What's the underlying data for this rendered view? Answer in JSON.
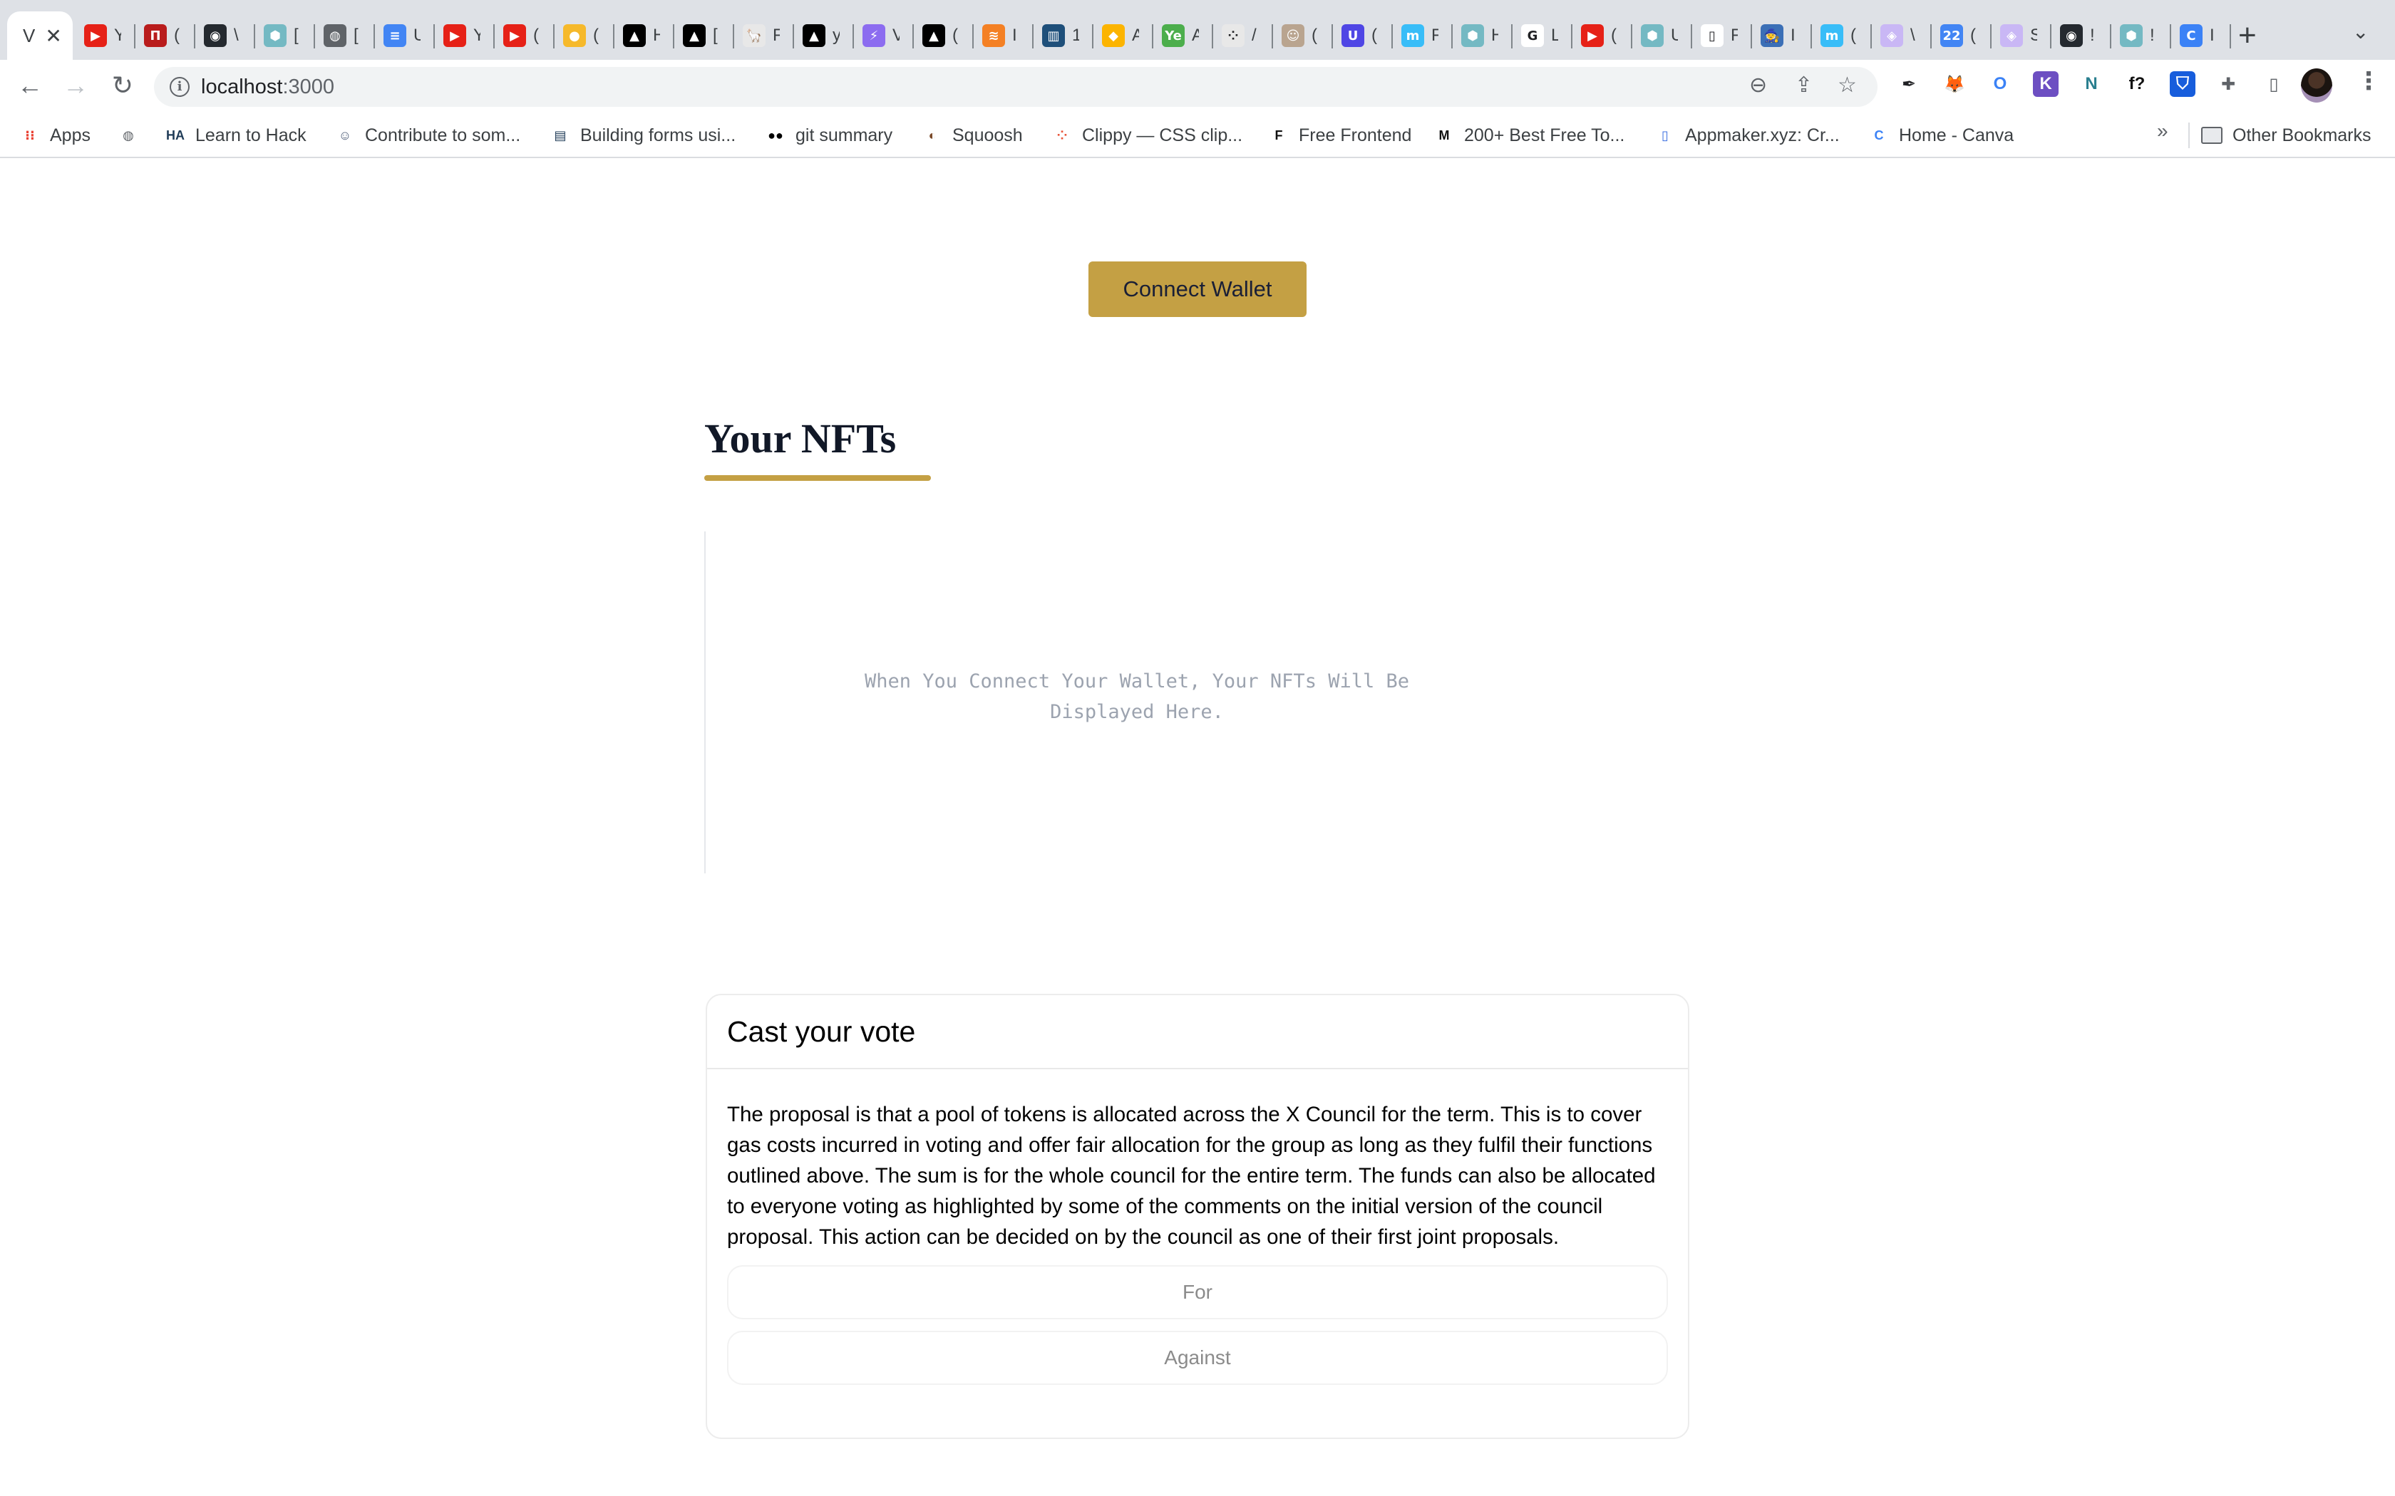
{
  "browser": {
    "active_tab": {
      "label": "V",
      "close": "✕"
    },
    "tabs": [
      {
        "icon": "youtube-music-icon",
        "label": "Y",
        "color": "#e62117",
        "glyph": "▶"
      },
      {
        "icon": "mdn-icon",
        "label": "(",
        "color": "#b91c1c",
        "glyph": "П"
      },
      {
        "icon": "github-icon",
        "label": "\\",
        "color": "#24292f",
        "glyph": "◉"
      },
      {
        "icon": "cube-icon",
        "label": "[",
        "color": "#74b9c3",
        "glyph": "⬢"
      },
      {
        "icon": "globe-icon",
        "label": "[",
        "color": "#5f6368",
        "glyph": "◍"
      },
      {
        "icon": "google-docs-icon",
        "label": "U",
        "color": "#4285f4",
        "glyph": "≡"
      },
      {
        "icon": "youtube-music-icon",
        "label": "Y",
        "color": "#e62117",
        "glyph": "▶"
      },
      {
        "icon": "youtube-icon",
        "label": "(",
        "color": "#e62117",
        "glyph": "▶"
      },
      {
        "icon": "keep-icon",
        "label": "(",
        "color": "#f6b92b",
        "glyph": "●"
      },
      {
        "icon": "vercel-icon",
        "label": "H",
        "color": "#000000",
        "glyph": "▲"
      },
      {
        "icon": "vercel-icon",
        "label": "[",
        "color": "#000000",
        "glyph": "▲"
      },
      {
        "icon": "llama-icon",
        "label": "F",
        "color": "#e8e8e8",
        "glyph": "🦙"
      },
      {
        "icon": "vercel-icon",
        "label": "y",
        "color": "#000000",
        "glyph": "▲"
      },
      {
        "icon": "vite-icon",
        "label": "V",
        "color": "#8c6cf0",
        "glyph": "⚡"
      },
      {
        "icon": "vercel-icon",
        "label": "(",
        "color": "#000000",
        "glyph": "▲"
      },
      {
        "icon": "stackoverflow-icon",
        "label": "I",
        "color": "#f48024",
        "glyph": "≋"
      },
      {
        "icon": "chart-image-icon",
        "label": "1",
        "color": "#1e4f7a",
        "glyph": "▥"
      },
      {
        "icon": "airtable-icon",
        "label": "A",
        "color": "#fcb400",
        "glyph": "◆"
      },
      {
        "icon": "ye-icon",
        "label": "A",
        "color": "#4cae4c",
        "glyph": "Ye"
      },
      {
        "icon": "dots-icon",
        "label": "/",
        "color": "#e8e8e8",
        "glyph": "⁘"
      },
      {
        "icon": "photo-icon",
        "label": "(",
        "color": "#b9a48f",
        "glyph": "☺"
      },
      {
        "icon": "u-logo-icon",
        "label": "(",
        "color": "#4f46e5",
        "glyph": "U"
      },
      {
        "icon": "m-logo-icon",
        "label": "F",
        "color": "#38bdf8",
        "glyph": "m"
      },
      {
        "icon": "cube-icon",
        "label": "H",
        "color": "#74b9c3",
        "glyph": "⬢"
      },
      {
        "icon": "google-icon",
        "label": "L",
        "color": "#ffffff",
        "glyph": "G"
      },
      {
        "icon": "youtube-icon",
        "label": "(",
        "color": "#e62117",
        "glyph": "▶"
      },
      {
        "icon": "cube-icon",
        "label": "U",
        "color": "#74b9c3",
        "glyph": "⬢"
      },
      {
        "icon": "frame-icon",
        "label": "F",
        "color": "#ffffff",
        "glyph": "▯"
      },
      {
        "icon": "wizard-icon",
        "label": "I",
        "color": "#3b6fb6",
        "glyph": "🧙"
      },
      {
        "icon": "m-logo-icon",
        "label": "(",
        "color": "#38bdf8",
        "glyph": "m"
      },
      {
        "icon": "ethereum-icon",
        "label": "\\",
        "color": "#c9b7f5",
        "glyph": "◈"
      },
      {
        "icon": "google-calendar-icon",
        "label": "(",
        "color": "#4285f4",
        "glyph": "22"
      },
      {
        "icon": "ethereum-icon",
        "label": "S",
        "color": "#c9b7f5",
        "glyph": "◈"
      },
      {
        "icon": "github-icon",
        "label": "!",
        "color": "#24292f",
        "glyph": "◉"
      },
      {
        "icon": "cube-icon",
        "label": "!",
        "color": "#74b9c3",
        "glyph": "⬢"
      },
      {
        "icon": "canva-icon",
        "label": "I",
        "color": "#3b82f6",
        "glyph": "C"
      }
    ],
    "new_tab": "+",
    "tab_search": "⌄",
    "url_host": "localhost",
    "url_port": ":3000",
    "extensions": [
      {
        "icon": "eyedropper-icon",
        "glyph": "✒",
        "color": "#202124",
        "bg": "transparent"
      },
      {
        "icon": "metamask-icon",
        "glyph": "🦊",
        "color": "#e2761b",
        "bg": "transparent"
      },
      {
        "icon": "opera-icon",
        "glyph": "O",
        "color": "#3b82f6",
        "bg": "transparent"
      },
      {
        "icon": "k-extension-icon",
        "glyph": "K",
        "color": "#ffffff",
        "bg": "#6d4fc2"
      },
      {
        "icon": "n-extension-icon",
        "glyph": "N",
        "color": "#2a7f8f",
        "bg": "transparent"
      },
      {
        "icon": "font-finder-icon",
        "glyph": "f?",
        "color": "#111111",
        "bg": "transparent"
      },
      {
        "icon": "bitwarden-icon",
        "glyph": "⛉",
        "color": "#ffffff",
        "bg": "#175ddc"
      },
      {
        "icon": "extensions-puzzle-icon",
        "glyph": "✚",
        "color": "#5f6368",
        "bg": "transparent"
      },
      {
        "icon": "side-panel-icon",
        "glyph": "▯",
        "color": "#5f6368",
        "bg": "transparent"
      }
    ],
    "bookmarks": [
      {
        "icon": "apps-grid-icon",
        "glyph": "⁝⁝",
        "label": "Apps",
        "color": "#ea4335"
      },
      {
        "icon": "globe-icon",
        "glyph": "◍",
        "label": "",
        "color": "#5f6368"
      },
      {
        "icon": "ha-icon",
        "glyph": "HA",
        "label": "Learn to Hack",
        "color": "#1f3b57"
      },
      {
        "icon": "person-icon",
        "glyph": "☺",
        "label": "Contribute to som...",
        "color": "#51607a"
      },
      {
        "icon": "form-icon",
        "glyph": "▤",
        "label": "Building forms usi...",
        "color": "#1f3b57"
      },
      {
        "icon": "medium-icon",
        "glyph": "●●",
        "label": "git summary",
        "color": "#000000"
      },
      {
        "icon": "squoosh-icon",
        "glyph": "◐",
        "label": "Squoosh",
        "color": "#7a4a2a"
      },
      {
        "icon": "clippy-icon",
        "glyph": "⁘",
        "label": "Clippy — CSS clip...",
        "color": "#e8553a"
      },
      {
        "icon": "free-frontend-icon",
        "glyph": "F",
        "label": "Free Frontend",
        "color": "#111111"
      },
      {
        "icon": "medium-m-icon",
        "glyph": "M",
        "label": "200+ Best Free To...",
        "color": "#111111"
      },
      {
        "icon": "appmaker-icon",
        "glyph": "▯",
        "label": "Appmaker.xyz: Cr...",
        "color": "#3b6fe0"
      },
      {
        "icon": "canva-icon",
        "glyph": "C",
        "label": "Home - Canva",
        "color": "#3b82f6"
      }
    ],
    "bookmarks_overflow": "»",
    "other_bookmarks": "Other Bookmarks"
  },
  "page": {
    "connect_wallet_label": "Connect Wallet",
    "nfts_title": "Your NFTs",
    "nfts_empty_message": "When You Connect Your Wallet, Your NFTs Will Be Displayed Here.",
    "vote": {
      "title": "Cast your vote",
      "proposal": "The proposal is that a pool of tokens is allocated across the X Council for the term. This is to cover gas costs incurred in voting and offer fair allocation for the group as long as they fulfil their functions outlined above. The sum is for the whole council for the entire term. The funds can also be allocated to everyone voting as highlighted by some of the comments on the initial version of the council proposal. This action can be decided on by the council as one of their first joint proposals.",
      "options": [
        "For",
        "Against"
      ]
    }
  },
  "colors": {
    "accent_gold": "#c4a044",
    "button_text": "#1a1f36",
    "muted_text": "#9ca3af"
  }
}
